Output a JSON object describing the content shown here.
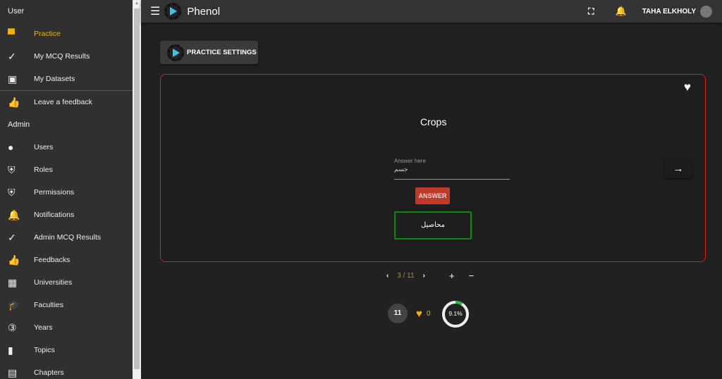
{
  "sidebar": {
    "user_section": "User",
    "user_items": [
      {
        "label": "Practice",
        "icon": "forum-icon",
        "glyph": "▀"
      },
      {
        "label": "My MCQ Results",
        "icon": "check-icon",
        "glyph": "✓"
      },
      {
        "label": "My Datasets",
        "icon": "save-icon",
        "glyph": "▣"
      },
      {
        "label": "Leave a feedback",
        "icon": "thumb-up-icon",
        "glyph": "👍"
      }
    ],
    "admin_section": "Admin",
    "admin_items": [
      {
        "label": "Users",
        "icon": "person-icon",
        "glyph": "●"
      },
      {
        "label": "Roles",
        "icon": "security-icon",
        "glyph": "⛨"
      },
      {
        "label": "Permissions",
        "icon": "security-icon",
        "glyph": "⛨"
      },
      {
        "label": "Notifications",
        "icon": "bell-icon",
        "glyph": "🔔"
      },
      {
        "label": "Admin MCQ Results",
        "icon": "check-icon",
        "glyph": "✓"
      },
      {
        "label": "Feedbacks",
        "icon": "thumb-up-icon",
        "glyph": "👍"
      },
      {
        "label": "Universities",
        "icon": "building-icon",
        "glyph": "▦"
      },
      {
        "label": "Faculties",
        "icon": "school-icon",
        "glyph": "🎓"
      },
      {
        "label": "Years",
        "icon": "filter-3-icon",
        "glyph": "③"
      },
      {
        "label": "Topics",
        "icon": "book-icon",
        "glyph": "▮"
      },
      {
        "label": "Chapters",
        "icon": "description-icon",
        "glyph": "▤"
      }
    ]
  },
  "header": {
    "app_name": "Phenol",
    "user_name": "TAHA ELKHOLY"
  },
  "main": {
    "settings_label": "PRACTICE SETTINGS",
    "question": "Crops",
    "answer_label": "Answer here",
    "answer_value": "جسم",
    "answer_button": "ANSWER",
    "correct_answer": "محاصيل",
    "pager": "3 / 11",
    "total": "11",
    "favorites": "0",
    "progress_text": "9.1%",
    "progress_value": 9.1,
    "progress_color": "#2db84d"
  }
}
